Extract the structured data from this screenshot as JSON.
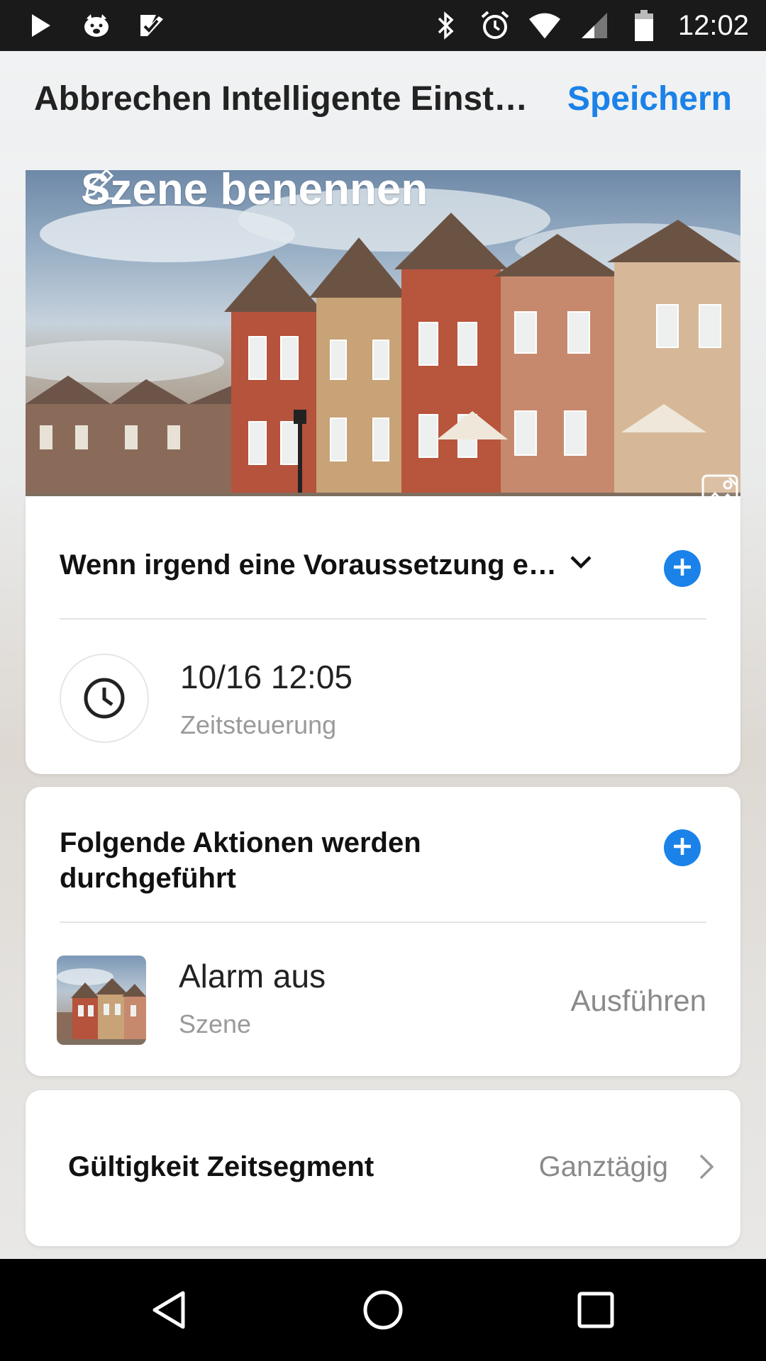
{
  "status_bar": {
    "time": "12:02",
    "icons_left": [
      "play-icon",
      "pig-icon",
      "check-icon"
    ],
    "icons_right": [
      "bluetooth-icon",
      "alarm-icon",
      "wifi-icon",
      "signal-icon",
      "battery-icon"
    ]
  },
  "header": {
    "title": "Abbrechen Intelligente Einst…",
    "save_label": "Speichern"
  },
  "hero": {
    "scene_name": "Szene benennen"
  },
  "conditions": {
    "title": "Wenn irgend eine Voraussetzung e…",
    "item": {
      "primary": "10/16 12:05",
      "secondary": "Zeitsteuerung"
    }
  },
  "actions": {
    "title_line1": "Folgende Aktionen werden",
    "title_line2": "durchgeführt",
    "item": {
      "primary": "Alarm aus",
      "secondary": "Szene",
      "run_label": "Ausführen"
    }
  },
  "validity": {
    "label": "Gültigkeit Zeitsegment",
    "value": "Ganztägig"
  },
  "colors": {
    "accent": "#1a82e8"
  }
}
